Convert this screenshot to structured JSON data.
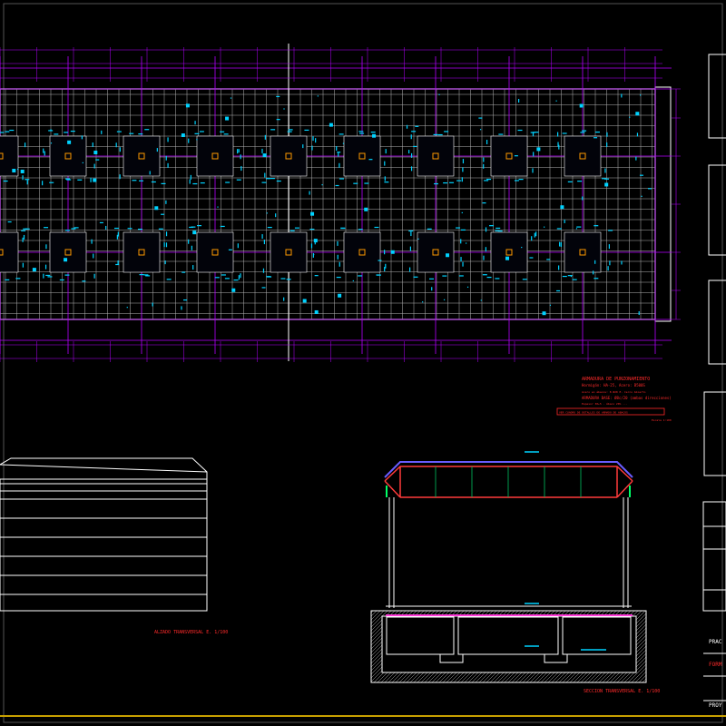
{
  "colors": {
    "background": "#000000",
    "grid_minor": "#b4b4b4",
    "grid_major": "#ffffff",
    "axis_lines": "#b400ff",
    "rebar": "#00d2ff",
    "columns": "#ff9a00",
    "dimension_text": "#ffd200",
    "note_text": "#ff2a2a",
    "frame": "#ffffff",
    "section_roof": "#ff3b3b",
    "section_top": "#6a5cff",
    "section_posts": "#00ff66",
    "section_bottom": "#ff3bd9"
  },
  "reinforcement_note": {
    "title": "ARMADURA DE PUNZONAMIENTO",
    "line2": "Hormigón: HA-25, Acero: B500S",
    "line3": "Acero en ábacos: 8 Ø20 E. Cerco Abierto",
    "line4": "ARMADURA BASE: Ø8c/20 (ambas direcciones)",
    "line5": "Espesor 30+5 . Ábaco 20% ...",
    "boxed": "VER CUADRO DE DETALLES DE ARMADO DE ABACOS",
    "scale": "Escala 1:100"
  },
  "elevation_label": "ALZADO TRANSVERSAL E. 1/100",
  "section_label": "SECCION TRANSVERSAL E. 1/100",
  "title_block": {
    "project_short": "PRAC",
    "format_short": "FORM",
    "project_label": "PROY"
  }
}
